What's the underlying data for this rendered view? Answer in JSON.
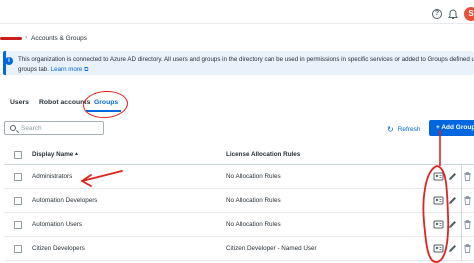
{
  "header": {
    "help_icon": "help-circle-icon",
    "bell_icon": "bell-icon",
    "avatar_initial": "S",
    "avatar_color": "#e8503a"
  },
  "breadcrumb": {
    "current": "Accounts & Groups"
  },
  "info_banner": {
    "line1": "This organization is connected to Azure AD directory. All users and groups in the directory can be used in permissions in specific services or added to Groups defined under",
    "line2": "groups tab.",
    "link_label": "Learn more"
  },
  "tabs": [
    {
      "label": "Users",
      "active": false
    },
    {
      "label": "Robot accounts",
      "active": false
    },
    {
      "label": "Groups",
      "active": true
    }
  ],
  "toolbar": {
    "search_placeholder": "Search",
    "refresh_label": "Refresh",
    "add_label": "+ Add Group"
  },
  "table": {
    "columns": [
      "Display Name",
      "License Allocation Rules"
    ],
    "sort_indicator": "▲",
    "rows": [
      {
        "name": "Administrators",
        "rules": "No Allocation Rules"
      },
      {
        "name": "Automation Developers",
        "rules": "No Allocation Rules"
      },
      {
        "name": "Automation Users",
        "rules": "No Allocation Rules"
      },
      {
        "name": "Citizen Developers",
        "rules": "Citizen Developer - Named User"
      }
    ]
  },
  "colors": {
    "accent": "#0067df",
    "annotation_red": "#e0231f"
  }
}
